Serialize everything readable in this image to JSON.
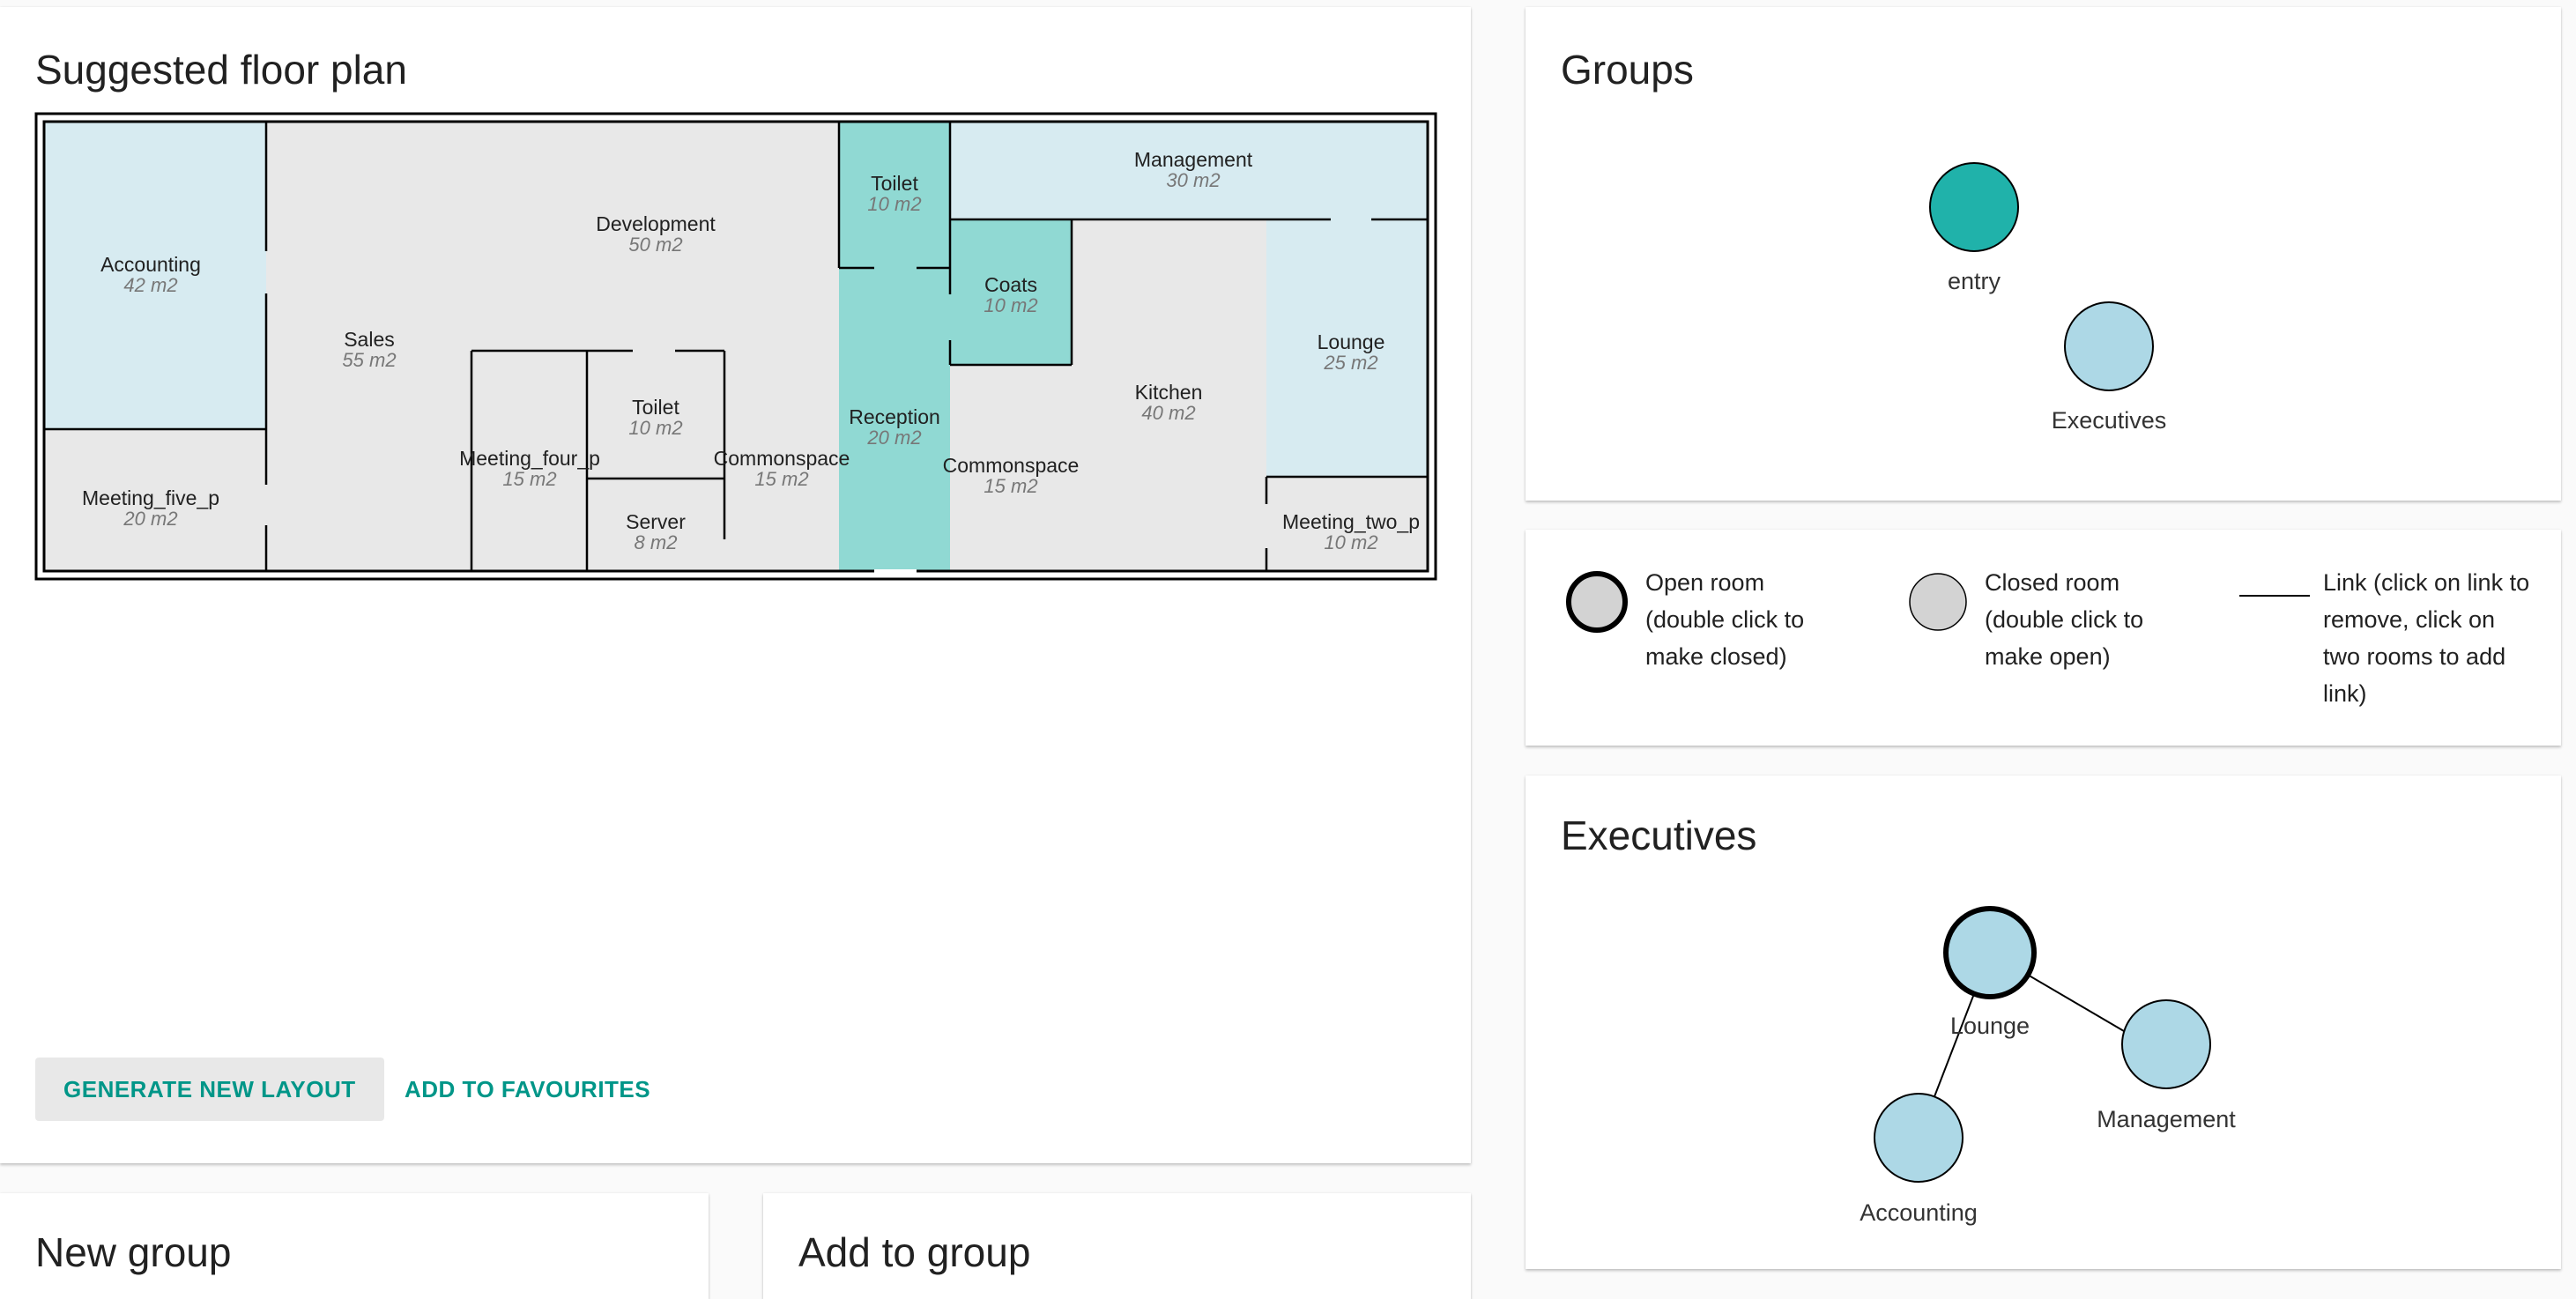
{
  "floor_plan": {
    "title": "Suggested floor plan",
    "rooms": [
      {
        "name": "Accounting",
        "area": "42 m2"
      },
      {
        "name": "Meeting_five_p",
        "area": "20 m2"
      },
      {
        "name": "Sales",
        "area": "55 m2"
      },
      {
        "name": "Development",
        "area": "50 m2"
      },
      {
        "name": "Meeting_four_p",
        "area": "15 m2"
      },
      {
        "name": "Toilet",
        "area": "10 m2"
      },
      {
        "name": "Server",
        "area": "8 m2"
      },
      {
        "name": "Commonspace",
        "area": "15 m2"
      },
      {
        "name": "Toilet",
        "area": "10 m2"
      },
      {
        "name": "Reception",
        "area": "20 m2"
      },
      {
        "name": "Coats",
        "area": "10 m2"
      },
      {
        "name": "Commonspace",
        "area": "15 m2"
      },
      {
        "name": "Management",
        "area": "30 m2"
      },
      {
        "name": "Kitchen",
        "area": "40 m2"
      },
      {
        "name": "Lounge",
        "area": "25 m2"
      },
      {
        "name": "Meeting_two_p",
        "area": "10 m2"
      }
    ],
    "generate_label": "GENERATE NEW LAYOUT",
    "favourites_label": "ADD TO FAVOURITES"
  },
  "groups": {
    "title": "Groups",
    "nodes": [
      {
        "label": "entry",
        "color": "#20b2aa"
      },
      {
        "label": "Executives",
        "color": "#add8e6"
      }
    ]
  },
  "legend": {
    "open_room": "Open room (double click to make closed)",
    "closed_room": "Closed room (double click to make open)",
    "link": "Link (click on link to remove, click on two rooms to add link)"
  },
  "executives": {
    "title": "Executives",
    "nodes": [
      {
        "label": "Lounge"
      },
      {
        "label": "Management"
      },
      {
        "label": "Accounting"
      }
    ]
  },
  "new_group": {
    "title": "New group"
  },
  "add_to_group": {
    "title": "Add to group"
  },
  "colors": {
    "accent": "#009688",
    "entry_room": "#90d9d3",
    "executive_room": "#d7ebf1",
    "other_room": "#e8e8e8",
    "entry_node": "#20b2aa",
    "executive_node": "#add8e6"
  }
}
